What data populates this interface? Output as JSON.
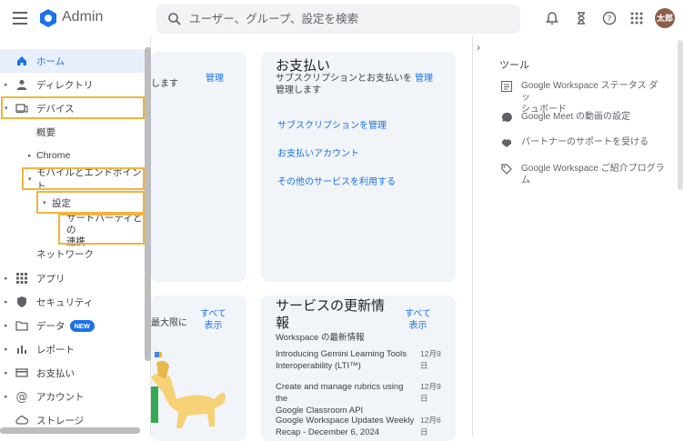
{
  "header": {
    "app_name": "Admin",
    "search_placeholder": "ユーザー、グループ、設定を検索",
    "avatar_text": "太郎",
    "icons": [
      "menu-icon",
      "admin-logo-icon",
      "search-icon",
      "bell-icon",
      "hourglass-icon",
      "help-icon",
      "apps-grid-icon"
    ]
  },
  "sidebar": {
    "home": "ホーム",
    "directory": "ディレクトリ",
    "devices": "デバイス",
    "overview": "概要",
    "chrome": "Chrome",
    "mobile": "モバイルとエンドポイント",
    "settings": "設定",
    "third_party_1": "サードパーティとの",
    "third_party_2": "連携",
    "network": "ネットワーク",
    "apps": "アプリ",
    "security": "セキュリティ",
    "data": "データ",
    "data_badge": "NEW",
    "reports": "レポート",
    "billing": "お支払い",
    "account": "アカウント",
    "storage": "ストレージ"
  },
  "cards": {
    "partial_top_text": "します",
    "partial_top_manage": "管理",
    "billing_title": "お支払い",
    "billing_sub1": "サブスクリプションとお支払いを",
    "billing_sub2": "管理します",
    "billing_manage": "管理",
    "billing_links": [
      "サブスクリプションを管理",
      "お支払いアカウント",
      "その他のサービスを利用する"
    ],
    "partial_bottom_text": "最大限に",
    "partial_bottom_all1": "すべて",
    "partial_bottom_all2": "表示",
    "updates_title1": "サービスの更新情",
    "updates_title2": "報",
    "updates_sub": "Workspace の最新情報",
    "updates_all1": "すべて",
    "updates_all2": "表示",
    "news": [
      {
        "t1": "Introducing Gemini Learning Tools",
        "t2": "Interoperability (LTI™)",
        "date": "12月9日"
      },
      {
        "t1": "Create and manage rubrics using the",
        "t2": "Google Classroom API",
        "date": "12月9日"
      },
      {
        "t1": "Google Workspace Updates Weekly",
        "t2": "Recap - December 6, 2024",
        "date": "12月6日"
      }
    ]
  },
  "tools": {
    "heading": "ツール",
    "items": [
      {
        "l1": "Google Workspace ステータス ダッ",
        "l2": "シュボード",
        "icon": "dashboard-icon"
      },
      {
        "l1": "Google Meet の動画の設定",
        "l2": "",
        "icon": "meet-icon"
      },
      {
        "l1": "パートナーのサポートを受ける",
        "l2": "",
        "icon": "handshake-icon"
      },
      {
        "l1": "Google Workspace ご紹介プログラム",
        "l2": "",
        "icon": "tag-icon"
      }
    ]
  },
  "colors": {
    "accent": "#1a73e8",
    "highlight": "#f2b33d",
    "card_bg": "#f1f4f9"
  }
}
